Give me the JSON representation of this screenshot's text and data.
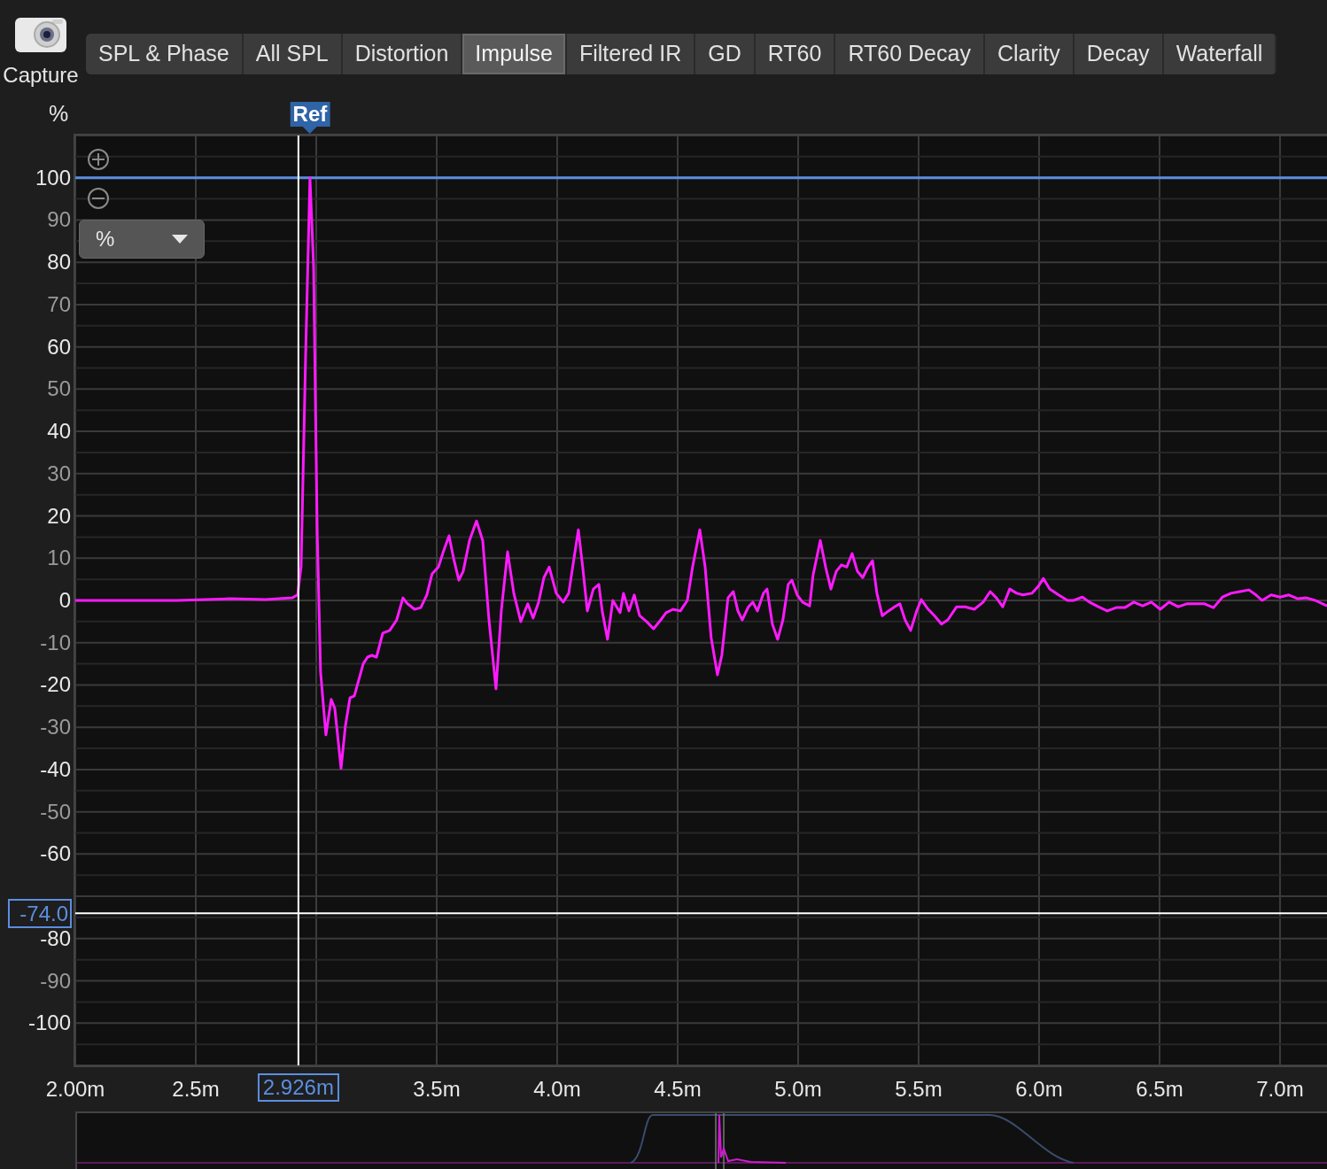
{
  "capture": {
    "label": "Capture"
  },
  "tabs": [
    {
      "label": "SPL & Phase",
      "selected": false
    },
    {
      "label": "All SPL",
      "selected": false
    },
    {
      "label": "Distortion",
      "selected": false
    },
    {
      "label": "Impulse",
      "selected": true
    },
    {
      "label": "Filtered IR",
      "selected": false
    },
    {
      "label": "GD",
      "selected": false
    },
    {
      "label": "RT60",
      "selected": false
    },
    {
      "label": "RT60 Decay",
      "selected": false
    },
    {
      "label": "Clarity",
      "selected": false
    },
    {
      "label": "Decay",
      "selected": false
    },
    {
      "label": "Waterfall",
      "selected": false
    }
  ],
  "unit_dropdown": {
    "value": "%"
  },
  "chart_data": {
    "type": "line",
    "ylabel": "%",
    "xlim": [
      2.0,
      7.195
    ],
    "ylim": [
      -110,
      110
    ],
    "xticks": [
      {
        "value": 2.0,
        "label": "2.00m"
      },
      {
        "value": 2.5,
        "label": "2.5m"
      },
      {
        "value": 3.5,
        "label": "3.5m"
      },
      {
        "value": 4.0,
        "label": "4.0m"
      },
      {
        "value": 4.5,
        "label": "4.5m"
      },
      {
        "value": 5.0,
        "label": "5.0m"
      },
      {
        "value": 5.5,
        "label": "5.5m"
      },
      {
        "value": 6.0,
        "label": "6.0m"
      },
      {
        "value": 6.5,
        "label": "6.5m"
      },
      {
        "value": 7.0,
        "label": "7.0m"
      }
    ],
    "yticks": [
      100,
      90,
      80,
      70,
      60,
      50,
      40,
      30,
      20,
      10,
      0,
      -10,
      -20,
      -30,
      -40,
      -50,
      -60,
      -80,
      -90,
      -100
    ],
    "grid": true,
    "x": [
      2.0,
      2.423,
      2.643,
      2.79,
      2.9,
      2.923,
      2.937,
      2.956,
      2.974,
      2.989,
      3.004,
      3.018,
      3.04,
      3.062,
      3.077,
      3.103,
      3.121,
      3.14,
      3.158,
      3.195,
      3.213,
      3.231,
      3.25,
      3.276,
      3.305,
      3.334,
      3.36,
      3.379,
      3.408,
      3.434,
      3.459,
      3.481,
      3.507,
      3.526,
      3.551,
      3.57,
      3.592,
      3.61,
      3.636,
      3.665,
      3.691,
      3.717,
      3.746,
      3.768,
      3.794,
      3.82,
      3.849,
      3.878,
      3.9,
      3.923,
      3.945,
      3.967,
      3.996,
      4.025,
      4.048,
      4.07,
      4.088,
      4.106,
      4.125,
      4.15,
      4.173,
      4.187,
      4.209,
      4.231,
      4.261,
      4.275,
      4.298,
      4.32,
      4.342,
      4.371,
      4.4,
      4.43,
      4.452,
      4.481,
      4.511,
      4.54,
      4.562,
      4.592,
      4.614,
      4.639,
      4.665,
      4.683,
      4.709,
      4.731,
      4.75,
      4.768,
      4.794,
      4.812,
      4.831,
      4.856,
      4.871,
      4.893,
      4.915,
      4.937,
      4.959,
      4.974,
      4.996,
      5.018,
      5.048,
      5.062,
      5.092,
      5.114,
      5.136,
      5.158,
      5.18,
      5.202,
      5.224,
      5.246,
      5.268,
      5.29,
      5.309,
      5.327,
      5.349,
      5.375,
      5.4,
      5.422,
      5.444,
      5.467,
      5.492,
      5.511,
      5.54,
      5.566,
      5.595,
      5.621,
      5.658,
      5.694,
      5.731,
      5.768,
      5.797,
      5.823,
      5.849,
      5.878,
      5.907,
      5.933,
      5.97,
      5.996,
      6.018,
      6.044,
      6.081,
      6.118,
      6.143,
      6.18,
      6.209,
      6.246,
      6.283,
      6.32,
      6.356,
      6.393,
      6.43,
      6.466,
      6.503,
      6.54,
      6.577,
      6.613,
      6.65,
      6.687,
      6.724,
      6.761,
      6.797,
      6.834,
      6.871,
      6.9,
      6.926,
      6.963,
      7.0,
      7.037,
      7.074,
      7.11,
      7.147,
      7.195
    ],
    "series": [
      {
        "color": "#ff1aff",
        "values": [
          0,
          0,
          0.4,
          0.2,
          0.6,
          1.3,
          8,
          58,
          100,
          79,
          16,
          -17,
          -31.8,
          -23.4,
          -25.5,
          -39.7,
          -29.7,
          -23,
          -22.6,
          -15,
          -13.4,
          -13,
          -13.4,
          -7.7,
          -7.1,
          -4.6,
          0.6,
          -0.8,
          -2.1,
          -1.7,
          1.3,
          6.3,
          7.9,
          11.3,
          15.3,
          10,
          4.8,
          6.9,
          14.2,
          18.8,
          14.2,
          -4.6,
          -20.9,
          -2.5,
          11.5,
          1.7,
          -5,
          -0.8,
          -4.2,
          -0.4,
          5.4,
          7.9,
          1.7,
          -0.4,
          1.7,
          10,
          16.7,
          7.9,
          -2.5,
          2.7,
          3.8,
          -2.5,
          -9.2,
          0,
          -2.9,
          1.7,
          -2.5,
          1.3,
          -3.6,
          -5,
          -6.7,
          -4.6,
          -2.9,
          -2.1,
          -2.5,
          0,
          7.9,
          16.7,
          7.9,
          -8.8,
          -17.6,
          -13,
          0.6,
          2.1,
          -2.5,
          -4.6,
          -1.5,
          -0.4,
          -2.5,
          1.7,
          2.7,
          -5.6,
          -9.2,
          -4.6,
          3.8,
          4.8,
          1.3,
          -0.4,
          -1.3,
          5.9,
          14.2,
          7.9,
          2.7,
          6.9,
          8.4,
          7.9,
          11.1,
          6.9,
          5.4,
          7.9,
          9.4,
          1.7,
          -3.6,
          -2.5,
          -1.5,
          -0.8,
          -4.6,
          -7.1,
          -2.5,
          0.2,
          -2.1,
          -3.6,
          -5.6,
          -4.6,
          -1.5,
          -1.5,
          -2.1,
          -0.4,
          2.1,
          0.6,
          -1.5,
          2.7,
          1.7,
          1.3,
          1.7,
          3.3,
          5.2,
          2.7,
          1.3,
          0,
          0,
          0.8,
          -0.4,
          -1.5,
          -2.5,
          -1.7,
          -1.7,
          -0.4,
          -1.3,
          -0.4,
          -2.1,
          -0.4,
          -1.5,
          -0.8,
          -0.8,
          -0.8,
          -1.7,
          0.8,
          1.7,
          2.1,
          2.5,
          1.3,
          0,
          1.3,
          0.8,
          1.3,
          0.4,
          0.6,
          0,
          -1.3
        ]
      }
    ],
    "ref_lines": [
      {
        "axis": "y",
        "value": 100,
        "color": "#5b8ee0"
      },
      {
        "axis": "x",
        "value": 2.926,
        "color": "#ffffff"
      },
      {
        "axis": "y",
        "value": -74.0,
        "color": "#ffffff"
      }
    ]
  },
  "ref_marker": {
    "label": "Ref"
  },
  "cursor": {
    "x_readout": "2.926m",
    "y_readout": "-74.0"
  }
}
